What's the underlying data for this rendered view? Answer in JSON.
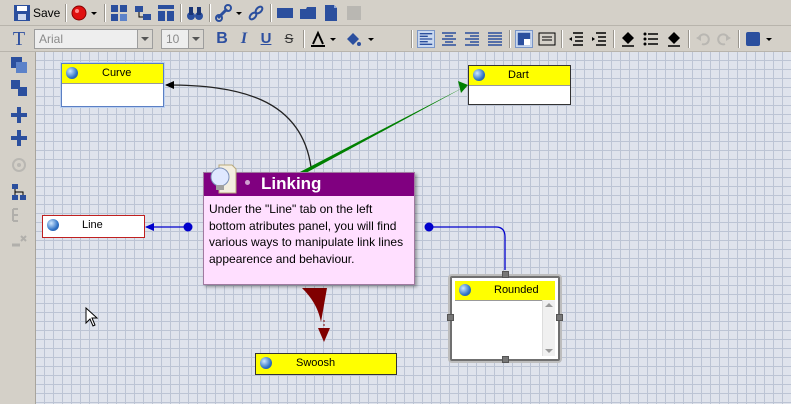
{
  "toolbar": {
    "save_label": "Save",
    "font_family": "Arial",
    "font_size": "10",
    "bold_label": "B",
    "italic_label": "I",
    "underline_label": "U",
    "strike_label": "S"
  },
  "nodes": {
    "curve": "Curve",
    "dart": "Dart",
    "line": "Line",
    "rounded": "Rounded",
    "swoosh": "Swoosh"
  },
  "tooltip": {
    "title": "Linking",
    "body": "Under the \"Line\" tab on the left bottom atributes panel, you will find various ways to manipulate link lines appearence and behaviour."
  },
  "colors": {
    "node_header": "#ffff00",
    "tooltip_header": "#800080",
    "tooltip_bg": "#ffdfff",
    "link_curve": "#222222",
    "link_dart": "#008000",
    "link_line": "#0000cc",
    "link_swoosh": "#800000"
  }
}
